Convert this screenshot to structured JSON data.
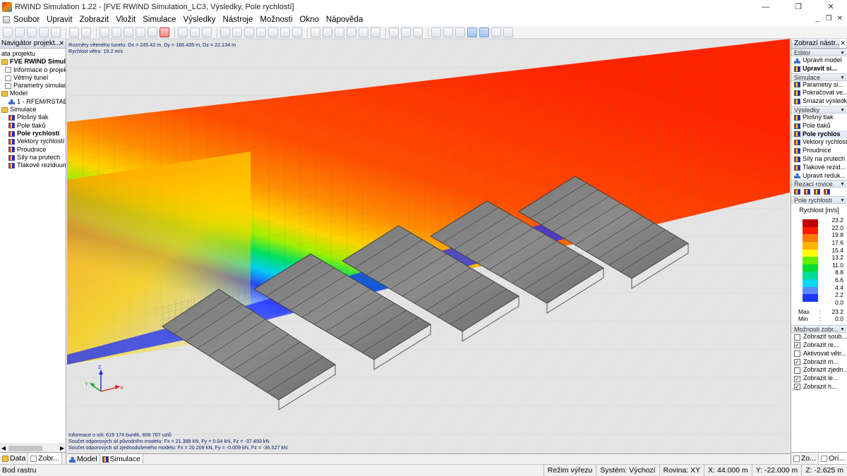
{
  "window": {
    "app_name": "RWIND Simulation 1.22",
    "title": "RWIND Simulation 1.22 - [FVE RWIND Simulation_LC3, Výsledky, Pole rychlostí]",
    "minimize_glyph": "—",
    "restore_glyph": "❐",
    "close_glyph": "✕"
  },
  "menu": {
    "items": [
      "Soubor",
      "Upravit",
      "Zobrazit",
      "Vložit",
      "Simulace",
      "Výsledky",
      "Nástroje",
      "Možnosti",
      "Okno",
      "Nápověda"
    ],
    "mdi_minimize": "_",
    "mdi_restore": "❐",
    "mdi_close": "✕"
  },
  "navigator": {
    "title": "Navigátor projekt...",
    "close_glyph": "✕",
    "items": [
      {
        "label": "ata projektu",
        "level": 0,
        "icon": "none",
        "bold": false
      },
      {
        "label": "FVE RWIND Simulation",
        "level": 0,
        "icon": "folder",
        "bold": true
      },
      {
        "label": "Informace o projektu",
        "level": 1,
        "icon": "doc",
        "bold": false
      },
      {
        "label": "Větrný tunel",
        "level": 1,
        "icon": "doc",
        "bold": false
      },
      {
        "label": "Parametry simulace",
        "level": 1,
        "icon": "doc",
        "bold": false
      },
      {
        "label": "Model",
        "level": 0,
        "icon": "folder",
        "bold": false
      },
      {
        "label": "1 - RFEM/RSTAB",
        "level": 2,
        "icon": "user",
        "bold": false
      },
      {
        "label": "Simulace",
        "level": 0,
        "icon": "folder",
        "bold": false
      },
      {
        "label": "Plošný tlak",
        "level": 2,
        "icon": "rb",
        "bold": false
      },
      {
        "label": "Pole tlaků",
        "level": 2,
        "icon": "rb",
        "bold": false
      },
      {
        "label": "Pole rychlostí",
        "level": 2,
        "icon": "rb",
        "bold": true
      },
      {
        "label": "Vektory rychlostí",
        "level": 2,
        "icon": "rb",
        "bold": false
      },
      {
        "label": "Proudnice",
        "level": 2,
        "icon": "rb",
        "bold": false
      },
      {
        "label": "Síly na prutech",
        "level": 2,
        "icon": "rb",
        "bold": false
      },
      {
        "label": "Tlakové reziduum",
        "level": 2,
        "icon": "rb",
        "bold": false
      }
    ],
    "tabs": [
      "Data",
      "Zobr..."
    ]
  },
  "viewport": {
    "info_top": [
      "Rozměry větrného tunelu: Dx = 245.42 m, Dy = 166.435 m, Dz = 22.134 m",
      "Rychlost větru: 19.2 m/s"
    ],
    "info_bottom": [
      "Informace o síti: 619 174 buněk, 806 767 uzlů",
      "Součet odporových sil původního modelu: Fx = 21.388 kN, Fy = 0.04 kN, Fz = -37.493 kN",
      "Součet odporových sil zjednodušeného modelu: Fx = 20.209 kN, Fy = -0.009 kN, Fz = -36.527 kN"
    ],
    "axis_x": "X",
    "axis_y": "Y",
    "axis_z": "Z"
  },
  "view_tabs": [
    "Model",
    "Simulace"
  ],
  "right_panel": {
    "title": "Zobrazí nástr...",
    "close_glyph": "✕",
    "sections": {
      "editor": {
        "label": "Editor",
        "items": [
          "Upravit model",
          "Upravit si..."
        ]
      },
      "simulace": {
        "label": "Simulace",
        "items": [
          "Parametry si...",
          "Pokračovat ve...",
          "Smazat výsledky"
        ]
      },
      "vysledky": {
        "label": "Výsledky",
        "items": [
          "Plošný tlak",
          "Pole tlaků",
          "Pole rychlos",
          "Vektory rychlostí",
          "Proudnice",
          "Síly na prutech",
          "Tlakové rezid...",
          "Upravit reduk..."
        ]
      },
      "rezaci": {
        "label": "Řezací rovice"
      },
      "pole": {
        "label": "Pole rychlostí"
      },
      "moznosti": {
        "label": "Možnosti zobr...",
        "items": [
          {
            "label": "Zobrazit soub...",
            "checked": false
          },
          {
            "label": "Zobrazit re...",
            "checked": true
          },
          {
            "label": "Aktivovat větr...",
            "checked": false
          },
          {
            "label": "Zobrazit m...",
            "checked": true
          },
          {
            "label": "Zobrazit zjedn...",
            "checked": false
          },
          {
            "label": "Zobrazit le...",
            "checked": true
          },
          {
            "label": "Zobrazit h...",
            "checked": true
          }
        ]
      }
    },
    "legend": {
      "title": "Rychlost [m/s]",
      "values": [
        "23.2",
        "22.0",
        "19.8",
        "17.6",
        "15.4",
        "13.2",
        "11.0",
        "8.8",
        "6.6",
        "4.4",
        "2.2",
        "0.0"
      ],
      "colors": [
        "#c00000",
        "#ff1a00",
        "#ff7a00",
        "#ffb300",
        "#ffff00",
        "#66ee00",
        "#00dd33",
        "#00dd99",
        "#00d8ee",
        "#5b8cff",
        "#1f36ff",
        "#0000c8"
      ],
      "max_label": "Max",
      "max_value": "23.2",
      "min_label": "Min",
      "min_value": "0.0"
    },
    "tabs": [
      "Zo...",
      "Orí..."
    ]
  },
  "statusbar": {
    "left": "Bod rastru",
    "cells": [
      "Režim výřezu",
      "Systém: Výchozí",
      "Rovina: XY",
      "X:  44.000 m",
      "Y:  -22.000 m",
      "Z:  -2.625 m"
    ]
  }
}
